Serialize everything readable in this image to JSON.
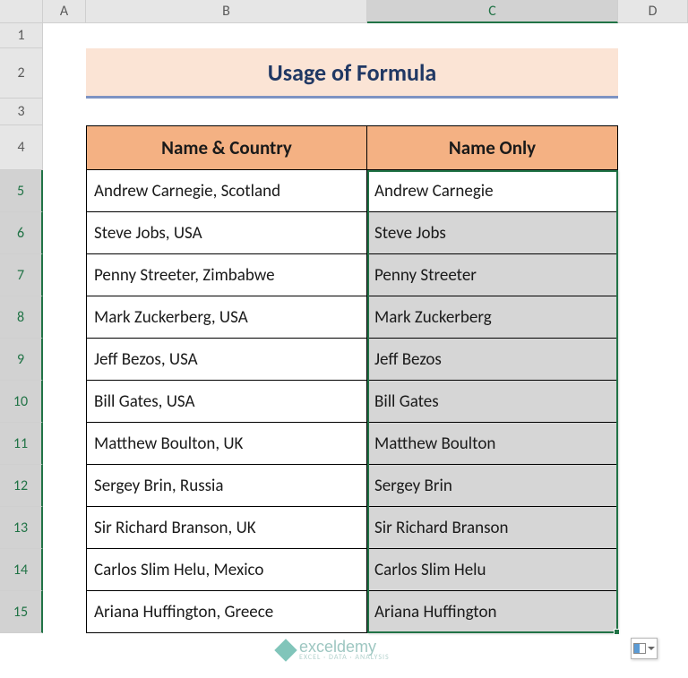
{
  "columns": {
    "A": "A",
    "B": "B",
    "C": "C",
    "D": "D"
  },
  "rows": [
    "1",
    "2",
    "3",
    "4",
    "5",
    "6",
    "7",
    "8",
    "9",
    "10",
    "11",
    "12",
    "13",
    "14",
    "15"
  ],
  "title": "Usage of Formula",
  "headers": {
    "b": "Name & Country",
    "c": "Name Only"
  },
  "data": [
    {
      "b": "Andrew Carnegie, Scotland",
      "c": "Andrew Carnegie"
    },
    {
      "b": "Steve Jobs, USA",
      "c": "Steve Jobs"
    },
    {
      "b": "Penny Streeter, Zimbabwe",
      "c": "Penny Streeter"
    },
    {
      "b": "Mark Zuckerberg, USA",
      "c": "Mark Zuckerberg"
    },
    {
      "b": "Jeff Bezos, USA",
      "c": "Jeff Bezos"
    },
    {
      "b": "Bill Gates, USA",
      "c": "Bill Gates"
    },
    {
      "b": "Matthew Boulton, UK",
      "c": "Matthew Boulton"
    },
    {
      "b": "Sergey Brin, Russia",
      "c": "Sergey Brin"
    },
    {
      "b": "Sir Richard Branson, UK",
      "c": "Sir Richard Branson"
    },
    {
      "b": "Carlos Slim Helu, Mexico",
      "c": "Carlos Slim Helu"
    },
    {
      "b": "Ariana Huffington, Greece",
      "c": "Ariana Huffington"
    }
  ],
  "watermark": {
    "name": "exceldemy",
    "sub": "EXCEL · DATA · ANALYSIS"
  }
}
